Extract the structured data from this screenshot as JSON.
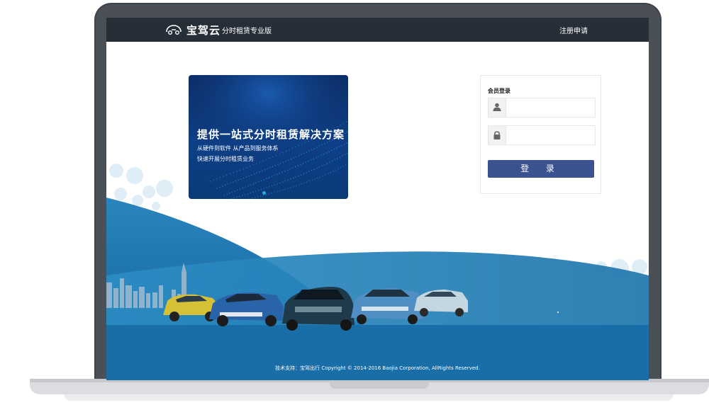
{
  "header": {
    "logo_name": "宝驾云",
    "logo_subtitle": "分时租赁专业版",
    "register_link": "注册申请"
  },
  "banner": {
    "title": "提供一站式分时租赁解决方案",
    "line1": "从硬件到软件 从产品到服务体系",
    "line2": "快速开展分时租赁业务"
  },
  "login": {
    "title": "会员登录",
    "username_icon": "user-icon",
    "password_icon": "lock-icon",
    "username_value": "",
    "password_value": "",
    "submit_label": "登 录"
  },
  "footer": {
    "copyright": "技术支持：宝驾出行 Copyright © 2014-2016 Baojia Corporation, AllRights Reserved."
  },
  "colors": {
    "header_bg": "#262f38",
    "login_button": "#3a5290",
    "wave_dark": "#1e6fa6",
    "wave_light": "#2f8fc4"
  }
}
